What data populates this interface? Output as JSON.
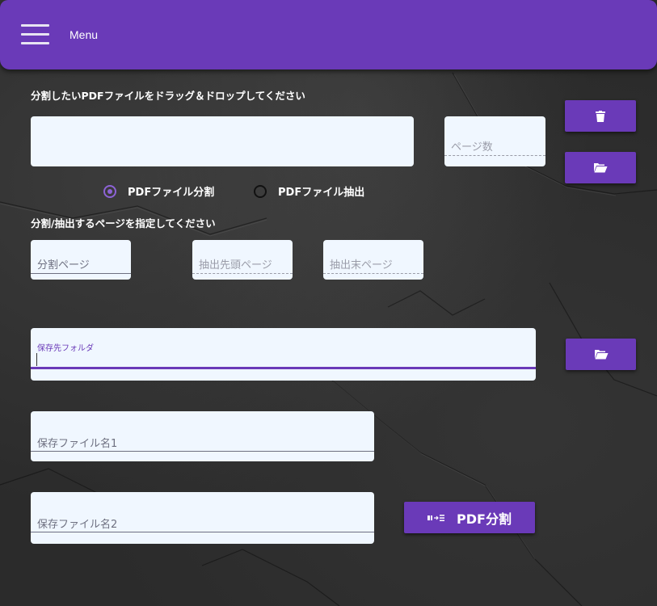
{
  "appbar": {
    "menu_label": "Menu"
  },
  "drop": {
    "instruction": "分割したいPDFファイルをドラッグ＆ドロップしてください",
    "page_count_placeholder": "ページ数"
  },
  "mode": {
    "split_label": "PDFファイル分割",
    "extract_label": "PDFファイル抽出",
    "selected": "split"
  },
  "pages": {
    "instruction": "分割/抽出するページを指定してください",
    "split_page_placeholder": "分割ページ",
    "extract_start_placeholder": "抽出先頭ページ",
    "extract_end_placeholder": "抽出末ページ"
  },
  "output": {
    "folder_label": "保存先フォルダ",
    "file1_placeholder": "保存ファイル名1",
    "file2_placeholder": "保存ファイル名2"
  },
  "action": {
    "split_button_label": "PDF分割"
  },
  "icons": {
    "menu": "hamburger-menu-icon",
    "delete": "trash-icon",
    "open_file": "folder-open-icon",
    "open_folder": "folder-open-icon",
    "split": "split-icon"
  },
  "colors": {
    "accent": "#6a3ab8",
    "field_bg": "#f0f7ff",
    "focus_underline": "#6a3ab8"
  }
}
